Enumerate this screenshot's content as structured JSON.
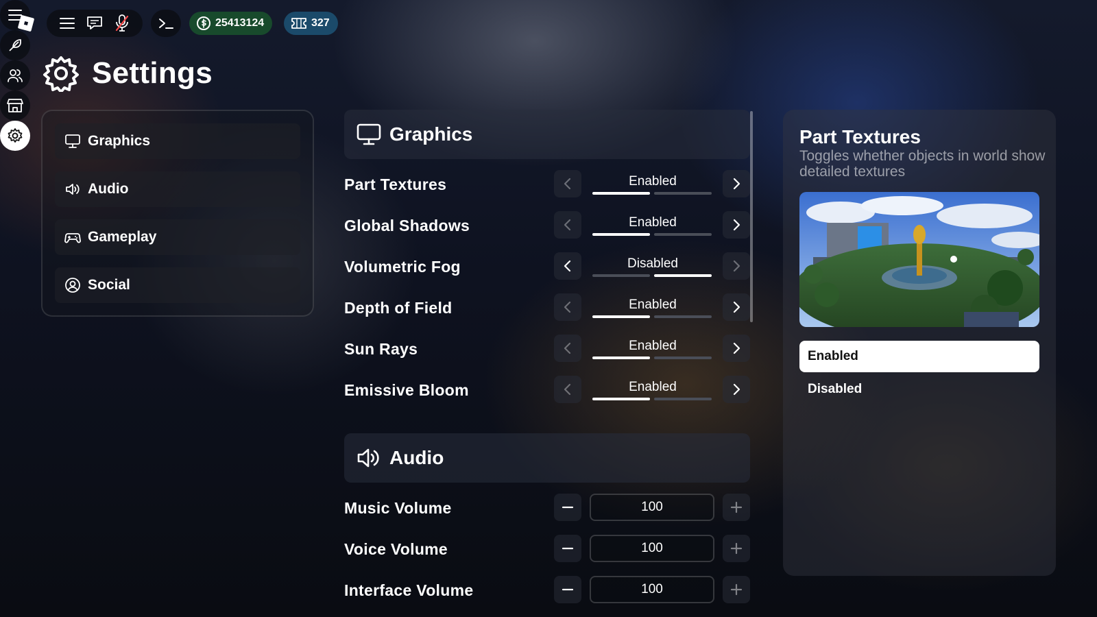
{
  "topbar": {
    "robux_amount": "25413124",
    "tickets_amount": "327"
  },
  "page": {
    "title": "Settings"
  },
  "sidebar": {
    "items": [
      {
        "label": "Graphics",
        "icon": "monitor-icon"
      },
      {
        "label": "Audio",
        "icon": "speaker-icon"
      },
      {
        "label": "Gameplay",
        "icon": "gamepad-icon"
      },
      {
        "label": "Social",
        "icon": "user-circle-icon"
      }
    ]
  },
  "graphics": {
    "title": "Graphics",
    "settings": [
      {
        "label": "Part Textures",
        "value": "Enabled",
        "index": 0,
        "count": 2
      },
      {
        "label": "Global Shadows",
        "value": "Enabled",
        "index": 0,
        "count": 2
      },
      {
        "label": "Volumetric Fog",
        "value": "Disabled",
        "index": 1,
        "count": 2
      },
      {
        "label": "Depth of Field",
        "value": "Enabled",
        "index": 0,
        "count": 2
      },
      {
        "label": "Sun Rays",
        "value": "Enabled",
        "index": 0,
        "count": 2
      },
      {
        "label": "Emissive Bloom",
        "value": "Enabled",
        "index": 0,
        "count": 2
      }
    ]
  },
  "audio": {
    "title": "Audio",
    "settings": [
      {
        "label": "Music Volume",
        "value": "100"
      },
      {
        "label": "Voice Volume",
        "value": "100"
      },
      {
        "label": "Interface Volume",
        "value": "100"
      }
    ]
  },
  "detail": {
    "title": "Part Textures",
    "description": "Toggles whether objects in world show detailed textures",
    "options": [
      "Enabled",
      "Disabled"
    ],
    "selected": "Enabled"
  },
  "colors": {
    "robux_pill": "#184a2c",
    "tickets_pill": "#1b4a6a",
    "active_bar": "#ffffff",
    "inactive_bar": "#4a4e58"
  }
}
